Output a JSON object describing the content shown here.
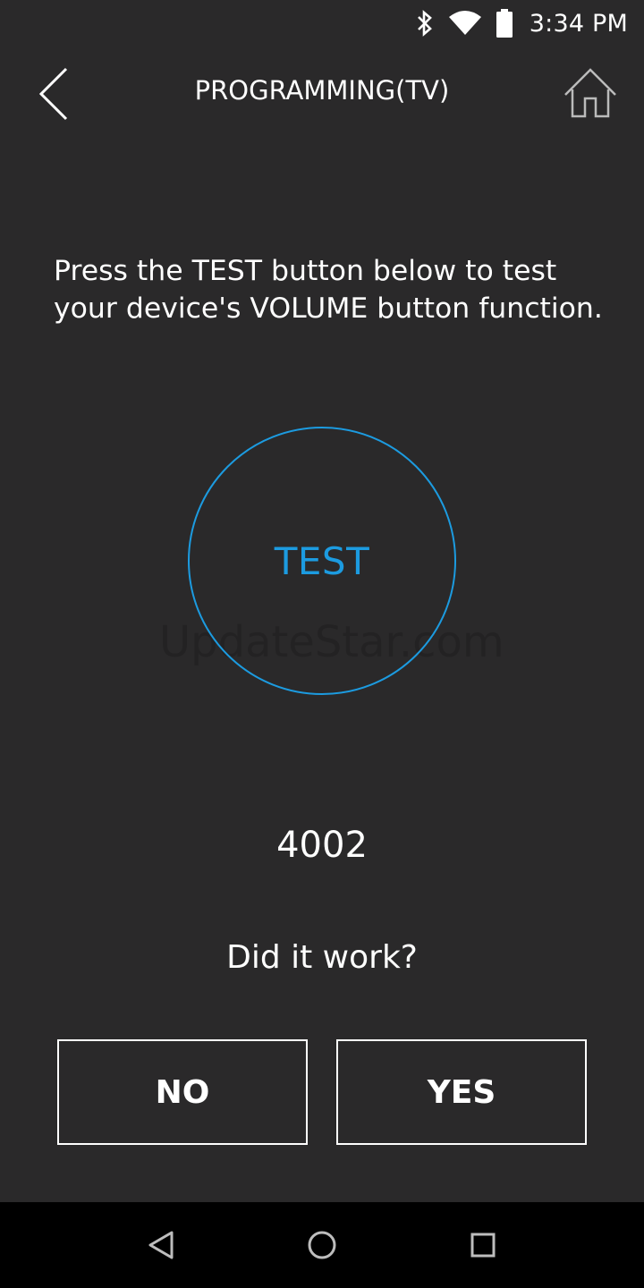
{
  "status_bar": {
    "time": "3:34 PM",
    "icons": [
      "bluetooth-icon",
      "wifi-icon",
      "battery-icon"
    ]
  },
  "header": {
    "title": "PROGRAMMING(TV)",
    "back_icon": "chevron-left-icon",
    "home_icon": "home-icon"
  },
  "instruction": {
    "text": "Press the TEST button below to test your device's VOLUME button function."
  },
  "test_button": {
    "label": "TEST",
    "accent_color": "#1c9be0"
  },
  "watermark": {
    "text": "UpdateStar.com"
  },
  "code": {
    "value": "4002"
  },
  "question": {
    "text": "Did it work?"
  },
  "answers": {
    "no_label": "NO",
    "yes_label": "YES"
  },
  "nav_bar": {
    "icons": [
      "nav-back-icon",
      "nav-home-icon",
      "nav-recents-icon"
    ]
  },
  "colors": {
    "background": "#2a292a",
    "text": "#ffffff",
    "accent": "#1c9be0",
    "nav_background": "#000000"
  }
}
